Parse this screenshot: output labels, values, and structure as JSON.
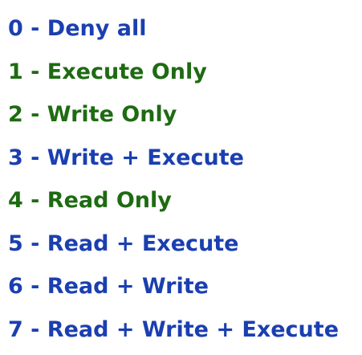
{
  "items": [
    {
      "text": "0 - Deny all",
      "color": "#1a3fb0"
    },
    {
      "text": "1 - Execute Only",
      "color": "#1e6b12"
    },
    {
      "text": "2 - Write Only",
      "color": "#1e6b12"
    },
    {
      "text": "3 - Write + Execute",
      "color": "#1a3fb0"
    },
    {
      "text": "4 - Read Only",
      "color": "#1e6b12"
    },
    {
      "text": "5 - Read + Execute",
      "color": "#1a3fb0"
    },
    {
      "text": "6 - Read + Write",
      "color": "#1a3fb0"
    },
    {
      "text": "7 - Read + Write + Execute",
      "color": "#1a3fb0"
    }
  ]
}
